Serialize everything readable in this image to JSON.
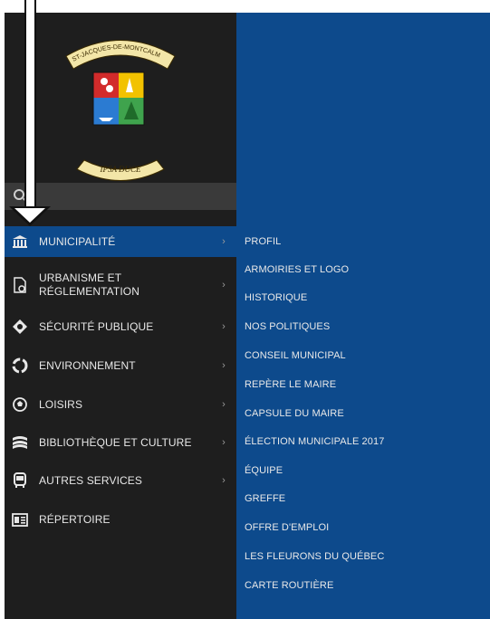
{
  "logo": {
    "banner_top": "ST-JACQUES-DE-MONTCALM",
    "banner_bottom": "IPSA DUCE"
  },
  "colors": {
    "sidebar_bg": "#1e1e1e",
    "panel_bg": "#0d4a8c",
    "search_bg": "#3a3a3a",
    "text": "#e8e8e8"
  },
  "menu": {
    "items": [
      {
        "label": "MUNICIPALITÉ",
        "icon": "building-columns-icon",
        "has_submenu": true,
        "active": true
      },
      {
        "label": "URBANISME ET RÉGLEMENTATION",
        "icon": "document-settings-icon",
        "has_submenu": true
      },
      {
        "label": "SÉCURITÉ PUBLIQUE",
        "icon": "safety-icon",
        "has_submenu": true
      },
      {
        "label": "ENVIRONNEMENT",
        "icon": "recycle-icon",
        "has_submenu": true
      },
      {
        "label": "LOISIRS",
        "icon": "soccer-ball-icon",
        "has_submenu": true
      },
      {
        "label": "BIBLIOTHÈQUE ET CULTURE",
        "icon": "books-icon",
        "has_submenu": true
      },
      {
        "label": "AUTRES SERVICES",
        "icon": "bus-icon",
        "has_submenu": true
      },
      {
        "label": "RÉPERTOIRE",
        "icon": "directory-icon",
        "has_submenu": false
      }
    ]
  },
  "submenu": {
    "items": [
      "PROFIL",
      "ARMOIRIES ET LOGO",
      "HISTORIQUE",
      "NOS POLITIQUES",
      "CONSEIL MUNICIPAL",
      "REPÈRE LE MAIRE",
      "CAPSULE DU MAIRE",
      "ÉLECTION MUNICIPALE 2017",
      "ÉQUIPE",
      "GREFFE",
      "OFFRE D'EMPLOI",
      "LES FLEURONS DU QUÉBEC",
      "CARTE ROUTIÈRE"
    ]
  }
}
